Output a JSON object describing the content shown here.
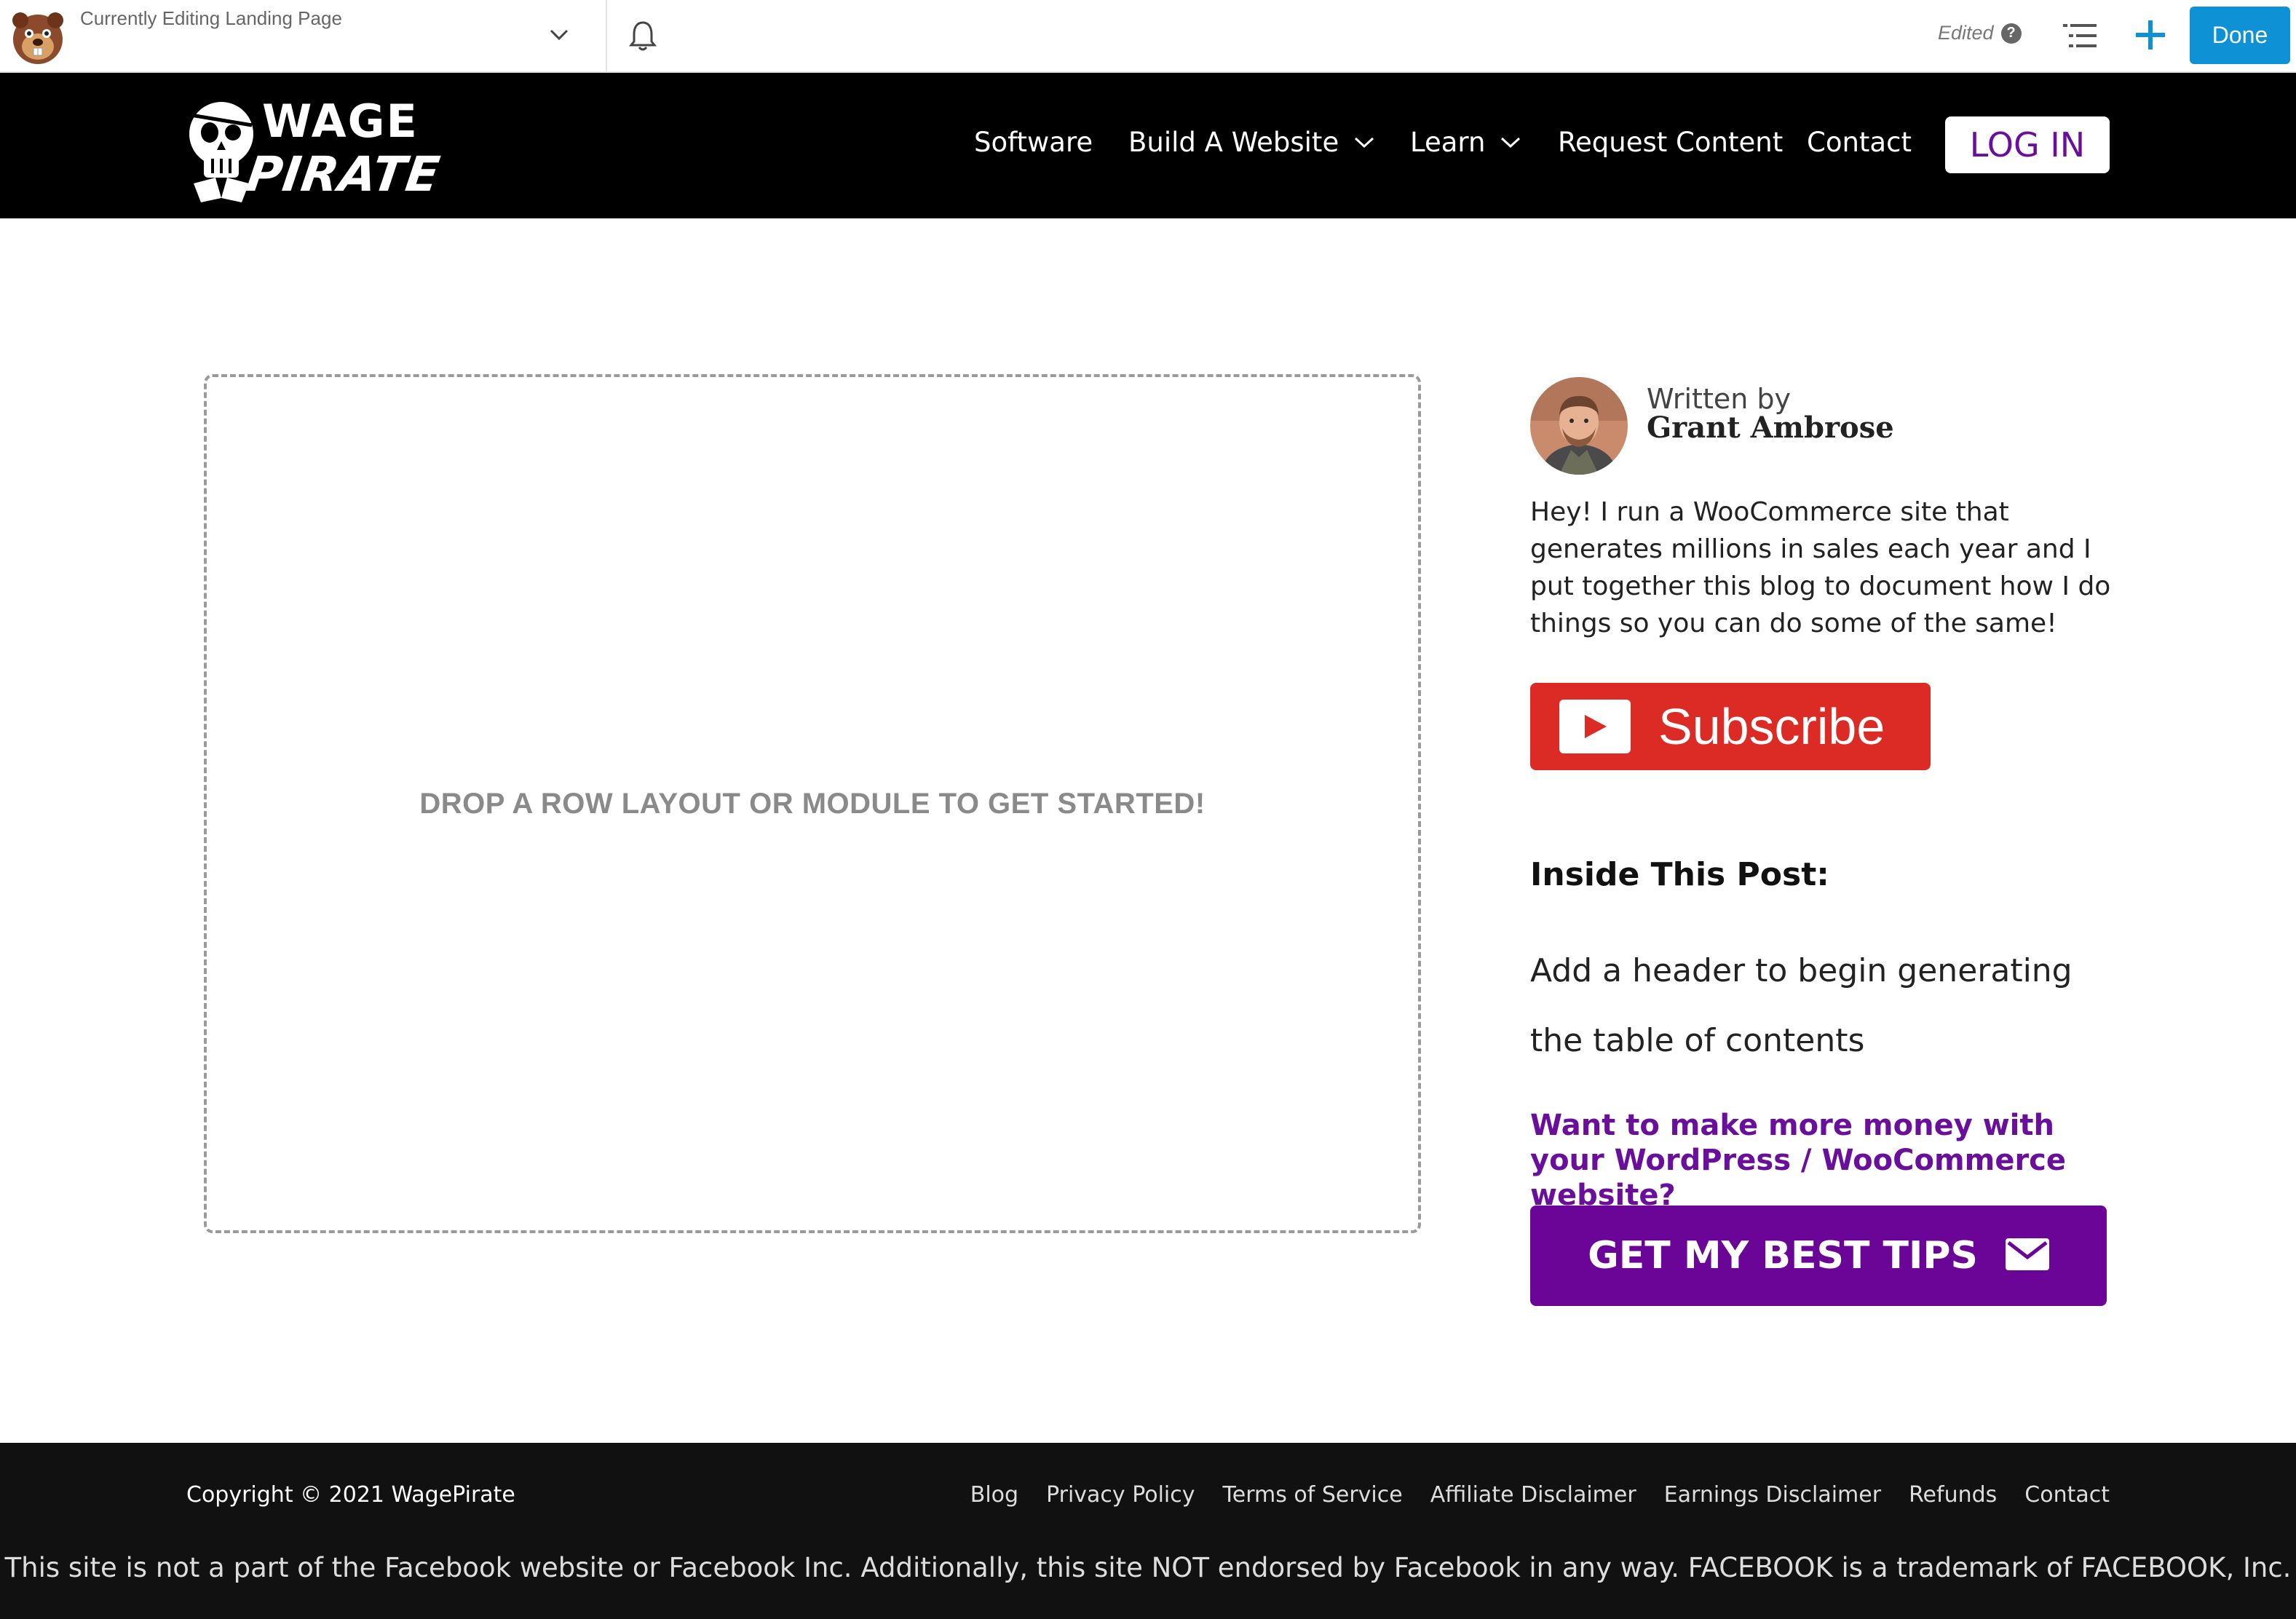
{
  "builder_bar": {
    "editing_label": "Currently Editing Landing Page",
    "status": "Edited",
    "help_icon": "question-circle-icon",
    "done_label": "Done",
    "accent": "#0e91d5"
  },
  "header": {
    "nav": [
      {
        "label": "Software",
        "has_dropdown": false
      },
      {
        "label": "Build A Website",
        "has_dropdown": true
      },
      {
        "label": "Learn",
        "has_dropdown": true
      },
      {
        "label": "Request Content",
        "has_dropdown": false
      },
      {
        "label": "Contact",
        "has_dropdown": false
      }
    ],
    "login_label": "LOG IN",
    "brand_color": "#6a0f9c"
  },
  "main": {
    "dropzone_text": "DROP A ROW LAYOUT OR MODULE TO GET STARTED!"
  },
  "sidebar": {
    "written_by": "Written by",
    "author_name": "Grant Ambrose",
    "bio": "Hey! I run a WooCommerce site that generates millions in sales each year and I put together this blog to document how I do things so you can do some of the same!",
    "subscribe_label": "Subscribe",
    "toc_title": "Inside This Post:",
    "toc_empty": "Add a header to begin generating the table of contents",
    "promo_text": "Want to make more money with your WordPress / WooCommerce website?",
    "tips_button": "GET MY BEST TIPS",
    "tips_icon": "envelope-icon"
  },
  "footer": {
    "copyright": "Copyright © 2021 WagePirate",
    "links": [
      "Blog",
      "Privacy Policy",
      "Terms of Service",
      "Affiliate Disclaimer",
      "Earnings Disclaimer",
      "Refunds",
      "Contact"
    ],
    "disclaimer": "This site is not a part of the Facebook website or Facebook Inc. Additionally, this site NOT endorsed by Facebook in any way. FACEBOOK is a trademark of FACEBOOK, Inc."
  }
}
